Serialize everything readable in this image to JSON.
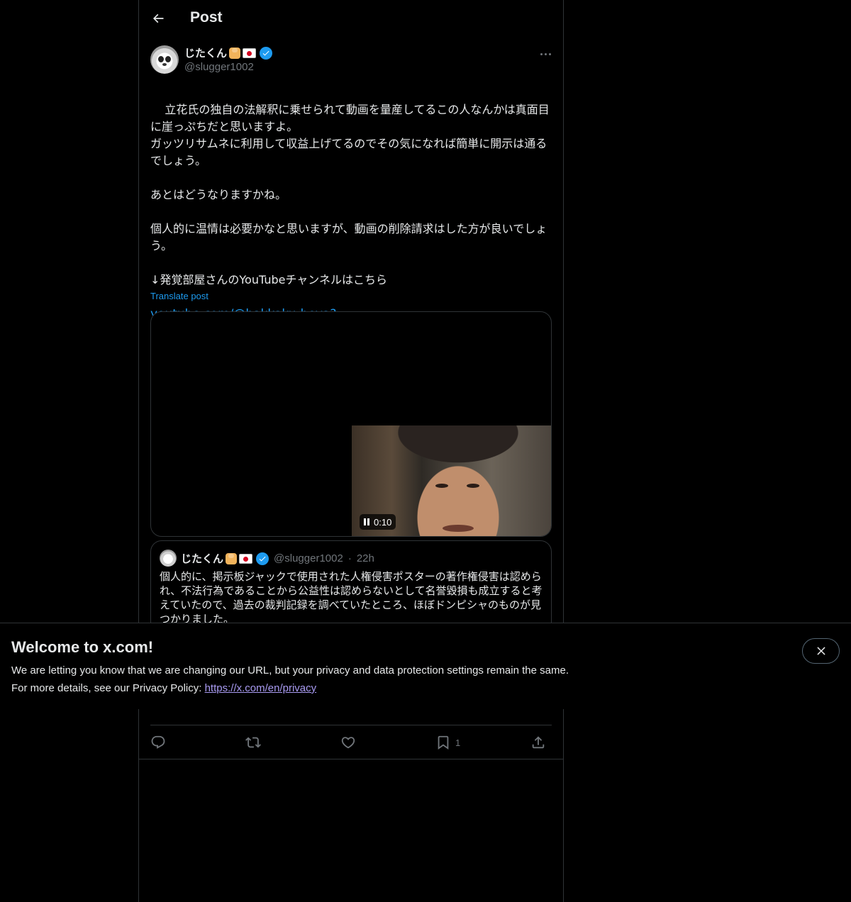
{
  "header": {
    "title": "Post"
  },
  "post": {
    "author_name": "じたくん",
    "author_handle": "@slugger1002",
    "text": "立花氏の独自の法解釈に乗せられて動画を量産してるこの人なんかは真面目に崖っぷちだと思いますよ。\nガッツリサムネに利用して収益上げてるのでその気になれば簡単に開示は通るでしょう。\n\nあとはどうなりますかね。\n\n個人的に温情は必要かなと思いますが、動画の削除請求はした方が良いでしょう。\n\n↓発覚部屋さんのYouTubeチャンネルはこちら",
    "link": "youtube.com/@hakkaku-beya?…",
    "translate_label": "Translate post",
    "video_time": "0:10"
  },
  "quote": {
    "author_name": "じたくん",
    "author_handle": "@slugger1002",
    "separator": "·",
    "time": "22h",
    "text": "個人的に、掲示板ジャックで使用された人権侵害ポスターの著作権侵害は認められ、不法行為であることから公益性は認めらないとして名誉毀損も成立すると考えていたので、過去の裁判記録を調べていたところ、ほぼドンピシャのものが見つかりました。"
  },
  "actions": {
    "bookmark_count": "1"
  },
  "banner": {
    "title": "Welcome to x.com!",
    "line1": "We are letting you know that we are changing our URL, but your privacy and data protection settings remain the same.",
    "line2_prefix": "For more details, see our Privacy Policy: ",
    "link": "https://x.com/en/privacy"
  },
  "icons": [
    "arrow-left-icon",
    "more-icon",
    "verified-badge-icon",
    "pause-icon",
    "reply-icon",
    "repost-icon",
    "like-icon",
    "bookmark-icon",
    "share-icon",
    "close-icon"
  ],
  "colors": {
    "accent": "#1d9bf0",
    "background": "#000000",
    "border": "#2f3336",
    "muted": "#71767b",
    "link_visited": "#a99bf2"
  }
}
